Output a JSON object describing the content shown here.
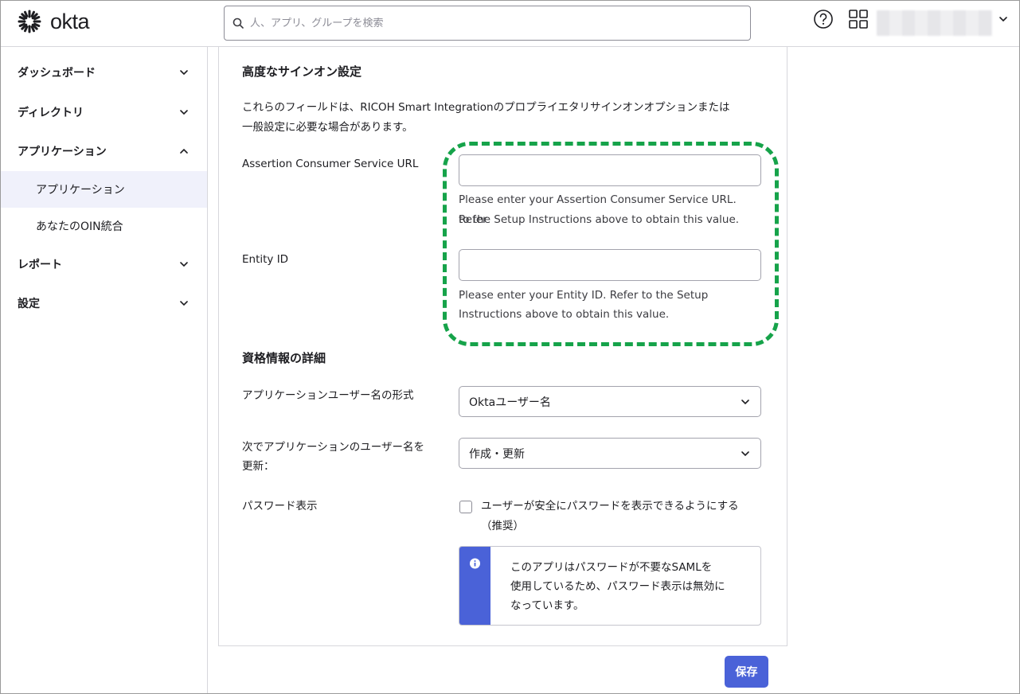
{
  "header": {
    "logo_text": "okta",
    "search_placeholder": "人、アプリ、グループを検索"
  },
  "sidebar": {
    "items": [
      {
        "label": "ダッシュボード"
      },
      {
        "label": "ディレクトリ"
      },
      {
        "label": "アプリケーション"
      },
      {
        "label": "レポート"
      },
      {
        "label": "設定"
      }
    ],
    "subitems": [
      {
        "label": "アプリケーション"
      },
      {
        "label": "あなたのOIN統合"
      }
    ]
  },
  "advanced": {
    "heading": "高度なサインオン設定",
    "desc_line1": "これらのフィールドは、RICOH Smart Integrationのプロプライエタリサインオンオプションまたは",
    "desc_line2": "一般設定に必要な場合があります。",
    "acs_label": "Assertion Consumer Service URL",
    "acs_value": "",
    "acs_hint_line1": "Please enter your Assertion Consumer Service URL. Refer",
    "acs_hint_line2": "to the Setup Instructions above to obtain this value.",
    "entity_label": "Entity ID",
    "entity_value": "",
    "entity_hint_line1": "Please enter your Entity ID. Refer to the Setup",
    "entity_hint_line2": "Instructions above to obtain this value."
  },
  "credentials": {
    "heading": "資格情報の詳細",
    "username_format_label": "アプリケーションユーザー名の形式",
    "username_format_value": "Oktaユーザー名",
    "update_label_line1": "次でアプリケーションのユーザー名を",
    "update_label_line2": "更新：",
    "update_value": "作成・更新",
    "password_label": "パスワード表示",
    "password_checkbox_line1": "ユーザーが安全にパスワードを表示できるようにする",
    "password_checkbox_line2": "（推奨）",
    "password_checked": false,
    "info_line1": "このアプリはパスワードが不要なSAMLを",
    "info_line2": "使用しているため、パスワード表示は無効に",
    "info_line3": "なっています。"
  },
  "actions": {
    "save_label": "保存"
  },
  "colors": {
    "accent": "#4a62d8",
    "highlight_dashed": "#16a34a"
  }
}
